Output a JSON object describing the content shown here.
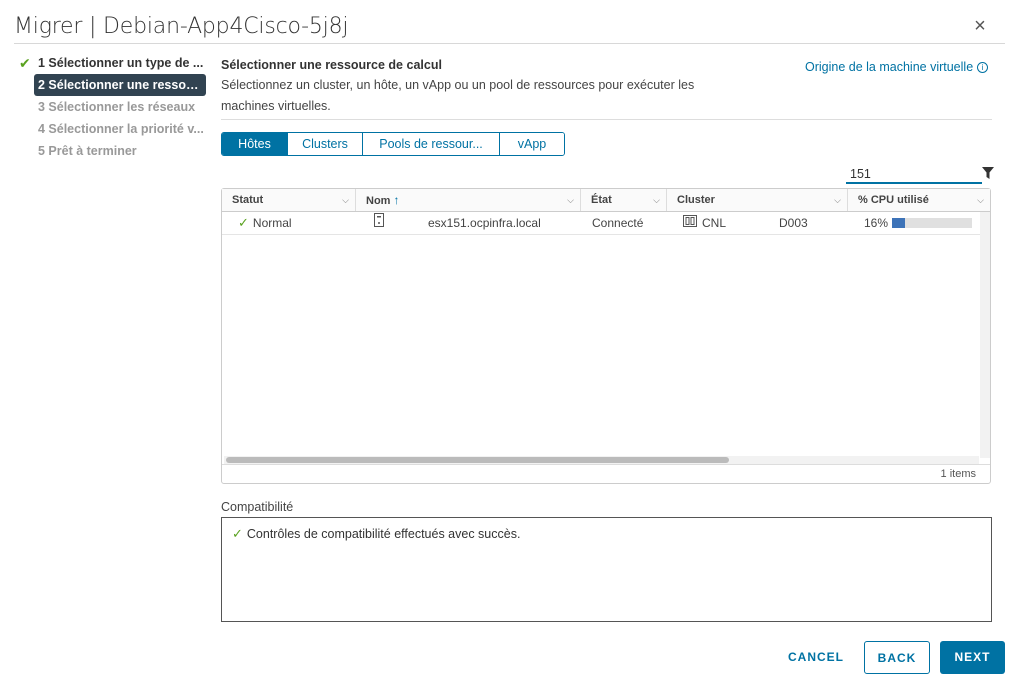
{
  "dialog": {
    "title": "Migrer | Debian-App4Cisco-5j8j",
    "close_glyph": "×"
  },
  "steps": [
    {
      "label": "1 Sélectionner un type de ...",
      "state": "done"
    },
    {
      "label": "2 Sélectionner une ressour...",
      "state": "active"
    },
    {
      "label": "3 Sélectionner les réseaux",
      "state": "pending"
    },
    {
      "label": "4 Sélectionner la priorité v...",
      "state": "pending"
    },
    {
      "label": "5 Prêt à terminer",
      "state": "pending"
    }
  ],
  "section": {
    "title": "Sélectionner une ressource de calcul",
    "description": "Sélectionnez un cluster, un hôte, un vApp ou un pool de ressources pour exécuter les machines virtuelles.",
    "vm_origin_link": "Origine de la machine virtuelle"
  },
  "tabs": [
    {
      "label": "Hôtes",
      "active": true
    },
    {
      "label": "Clusters",
      "active": false
    },
    {
      "label": "Pools de ressour...",
      "active": false
    },
    {
      "label": "vApp",
      "active": false
    }
  ],
  "filter": {
    "value": "151"
  },
  "grid": {
    "columns": [
      "Statut",
      "Nom",
      "État",
      "Cluster",
      "% CPU utilisé"
    ],
    "rows": [
      {
        "status": "Normal",
        "name": "esx151.ocpinfra.local",
        "state": "Connecté",
        "cluster_a": "CNL",
        "cluster_b": "D003",
        "cpu_text": "16%",
        "cpu_fraction": 0.16
      }
    ],
    "footer": "1 items"
  },
  "compatibility": {
    "label": "Compatibilité",
    "message": "Contrôles de compatibilité effectués avec succès."
  },
  "buttons": {
    "cancel": "CANCEL",
    "back": "BACK",
    "next": "NEXT"
  },
  "colors": {
    "accent": "#0072a3",
    "success": "#5aa220",
    "active_step_bg": "#314351",
    "cpu_fill": "#3d73b8"
  }
}
